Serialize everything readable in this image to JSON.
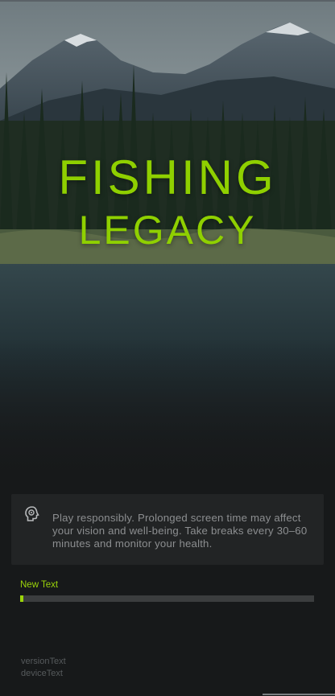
{
  "hero": {
    "title_line_1": "FISHING",
    "title_line_2": "LEGACY",
    "title_color": "#8fd000",
    "background_image": "mountain-lake-forest-landscape"
  },
  "notice": {
    "icon": "brain-head-icon",
    "text": "Play responsibly. Prolonged screen time may affect your vision and well-being. Take breaks every 30–60 minutes and monitor your health."
  },
  "loading": {
    "label": "New Text",
    "progress_fraction": 0.01,
    "accent_color": "#9bd40a"
  },
  "footer": {
    "version_text": "versionText",
    "device_text": "deviceText"
  }
}
